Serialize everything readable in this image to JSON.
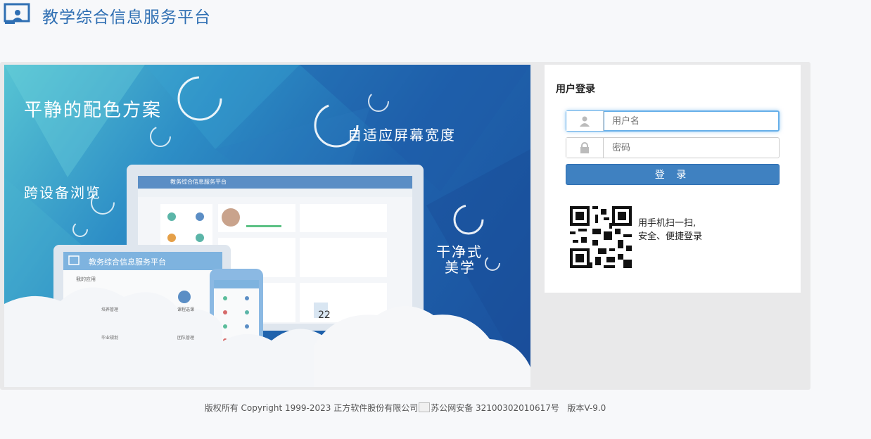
{
  "header": {
    "title": "教学综合信息服务平台",
    "logo_icon": "monitor-user-icon"
  },
  "banner": {
    "slogans": [
      "平静的配色方案",
      "自适应屏幕宽度",
      "跨设备浏览",
      "干净式",
      "美学"
    ],
    "device_title_desktop": "教务综合信息服务平台",
    "device_title_tablet": "教务综合信息服务平台",
    "tablet_section": "我的应用",
    "tablet_apps": [
      "培养管理",
      "课程选课",
      "毕业规划",
      "团队管理"
    ],
    "calendar_day": "22"
  },
  "login": {
    "title": "用户登录",
    "username_placeholder": "用户名",
    "password_placeholder": "密码",
    "button_label": "登 录",
    "user_icon": "user-icon",
    "lock_icon": "lock-icon",
    "qr_line1": "用手机扫一扫,",
    "qr_line2": "安全、便捷登录"
  },
  "footer": {
    "copyright": "版权所有 Copyright 1999-2023 正方软件股份有限公司",
    "record": "苏公网安备 32100302010617号",
    "version": "版本V-9.0"
  },
  "colors": {
    "brand": "#2f6fb3",
    "button": "#3f81c1",
    "background": "#f7f8fa"
  }
}
